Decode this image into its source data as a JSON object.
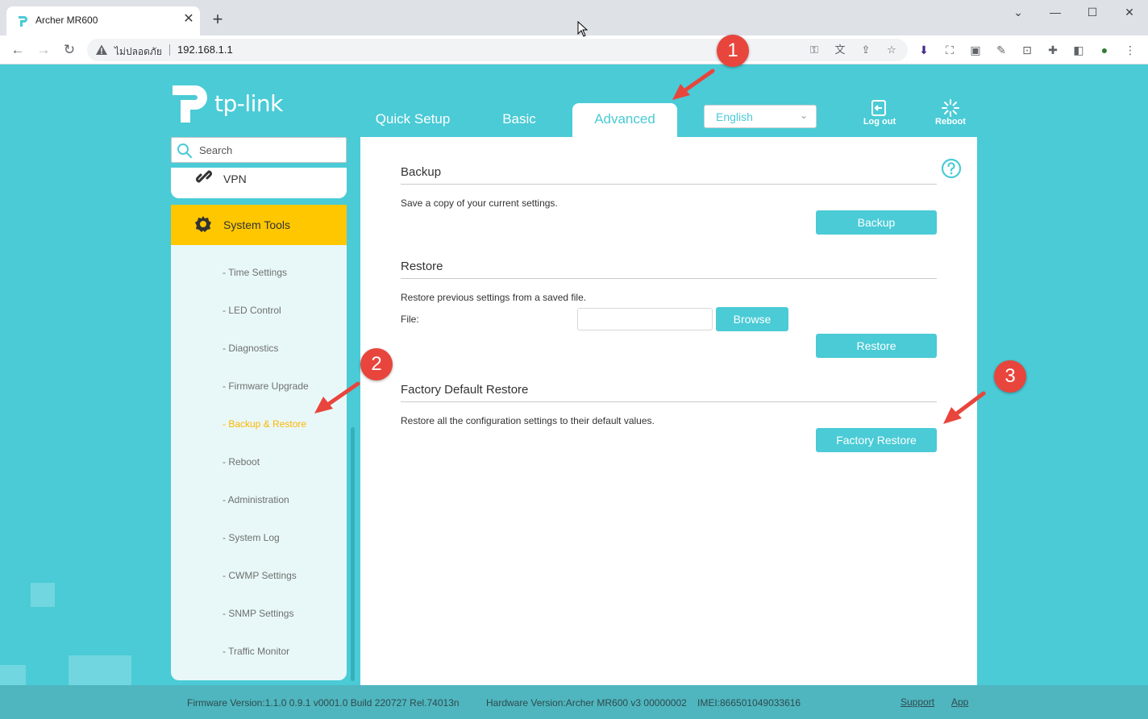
{
  "browser": {
    "tab_title": "Archer MR600",
    "tab_close": "✕",
    "new_tab": "+",
    "security_label": "ไม่ปลอดภัย",
    "url": "192.168.1.1"
  },
  "header": {
    "logo_text": "tp-link",
    "tabs": [
      {
        "label": "Quick Setup"
      },
      {
        "label": "Basic"
      },
      {
        "label": "Advanced"
      }
    ],
    "language": "English",
    "logout_label": "Log out",
    "reboot_label": "Reboot"
  },
  "sidebar": {
    "search_placeholder": "Search",
    "vpn_label": "VPN",
    "system_tools_label": "System Tools",
    "sub_items": [
      {
        "label": "- Time Settings"
      },
      {
        "label": "- LED Control"
      },
      {
        "label": "- Diagnostics"
      },
      {
        "label": "- Firmware Upgrade"
      },
      {
        "label": "- Backup & Restore"
      },
      {
        "label": "- Reboot"
      },
      {
        "label": "- Administration"
      },
      {
        "label": "- System Log"
      },
      {
        "label": "- CWMP Settings"
      },
      {
        "label": "- SNMP Settings"
      },
      {
        "label": "- Traffic Monitor"
      }
    ]
  },
  "content": {
    "backup": {
      "title": "Backup",
      "desc": "Save a copy of your current settings.",
      "button": "Backup"
    },
    "restore": {
      "title": "Restore",
      "desc": "Restore previous settings from a saved file.",
      "file_label": "File:",
      "browse_button": "Browse",
      "button": "Restore"
    },
    "factory": {
      "title": "Factory Default Restore",
      "desc": "Restore all the configuration settings to their default values.",
      "button": "Factory Restore"
    }
  },
  "footer": {
    "firmware": "Firmware Version:1.1.0 0.9.1 v0001.0 Build 220727 Rel.74013n",
    "hardware": "Hardware Version:Archer MR600 v3 00000002",
    "imei": "IMEI:866501049033616",
    "support": "Support",
    "app": "App"
  },
  "annotations": {
    "badge_1": "1",
    "badge_2": "2",
    "badge_3": "3"
  },
  "colors": {
    "accent": "#4acbd6",
    "active_nav": "#ffc700",
    "active_sub": "#ffb400",
    "annotation": "#e8453c"
  }
}
